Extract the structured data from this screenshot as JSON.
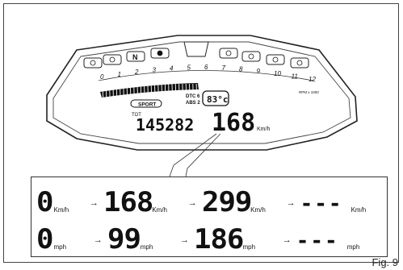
{
  "figure": {
    "caption": "Fig. 9"
  },
  "dashboard": {
    "warning_icons": [
      "neutral-left-icon",
      "engine-icon",
      "N",
      "abs-icon",
      "dtc-icon",
      "fuel-icon",
      "high-beam-icon",
      "oil-icon",
      "battery-icon"
    ],
    "rpm_ticks": [
      "0",
      "1",
      "2",
      "3",
      "4",
      "5",
      "6",
      "7",
      "8",
      "9",
      "10",
      "11",
      "12"
    ],
    "rpm_unit": "RPM x 1000",
    "dtc_label": "DTC 6",
    "abs_label": "ABS 2",
    "temp_value": "83°c",
    "mode_label": "SPORT",
    "odometer_label": "TOT",
    "odometer_value": "145282",
    "speed_value": "168",
    "speed_unit": "Km/h"
  },
  "panel": {
    "kmh_row": [
      {
        "value": "0",
        "unit": "Km/h"
      },
      {
        "value": "168",
        "unit": "Km/h"
      },
      {
        "value": "299",
        "unit": "Km/h"
      },
      {
        "value": "---",
        "unit": "Km/h"
      }
    ],
    "mph_row": [
      {
        "value": "0",
        "unit": "mph"
      },
      {
        "value": "99",
        "unit": "mph"
      },
      {
        "value": "186",
        "unit": "mph"
      },
      {
        "value": "---",
        "unit": "mph"
      }
    ],
    "arrow": "→"
  }
}
